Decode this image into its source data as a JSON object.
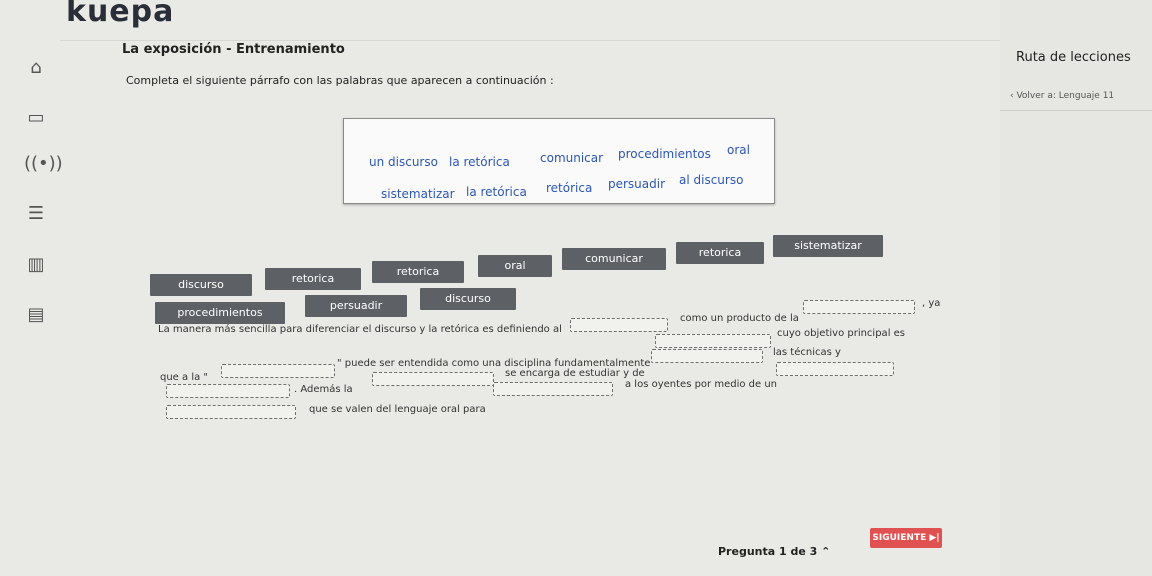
{
  "app": {
    "logo": "kuepa"
  },
  "lesson": {
    "title": "La exposición - Entrenamiento",
    "instruction": "Completa el siguiente párrafo con las palabras que aparecen a continuación :"
  },
  "word_bank": [
    "un discurso",
    "la retórica",
    "comunicar",
    "procedimientos",
    "oral",
    "sistematizar",
    "la retórica",
    "retórica",
    "persuadir",
    "al discurso"
  ],
  "options": [
    "discurso",
    "retorica",
    "retorica",
    "oral",
    "comunicar",
    "retorica",
    "sistematizar",
    "procedimientos",
    "persuadir",
    "discurso"
  ],
  "sentence": {
    "s1": "La manera más sencilla para diferenciar el discurso y la retórica es definiendo al",
    "s2": "como un producto de la",
    "s3": ", ya",
    "s4": "que a la \"",
    "s5": "\" puede ser entendida como una disciplina fundamentalmente",
    "s6": "cuyo objetivo principal es",
    "s7": ". Además la",
    "s8": "se encarga de estudiar y de",
    "s9": "las técnicas y",
    "s10": "que se valen del lenguaje oral para",
    "s11": "a los oyentes por medio de un"
  },
  "right_panel": {
    "title": "Ruta de lecciones",
    "back": "Volver a: Lenguaje 11"
  },
  "footer": {
    "question_counter": "Pregunta 1 de 3",
    "next_label": "SIGUIENTE ▶|"
  },
  "icons": [
    "home-icon",
    "calendar-icon",
    "broadcast-icon",
    "list-icon",
    "chart-icon",
    "note-icon"
  ],
  "colors": {
    "accent": "#e05252",
    "chip": "#5d6166",
    "wordbank_text": "#2d56b5"
  }
}
